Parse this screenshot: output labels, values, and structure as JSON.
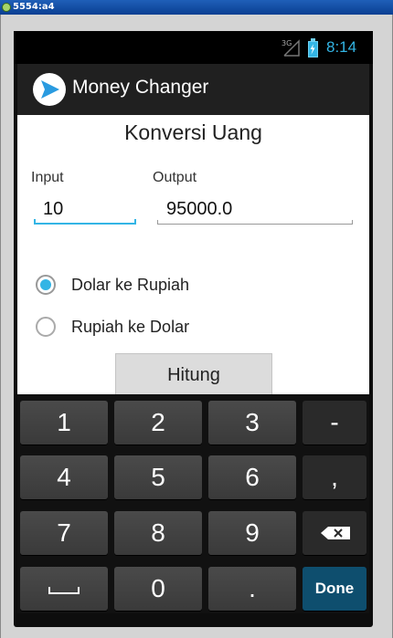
{
  "window": {
    "title": "5554:a4"
  },
  "statusbar": {
    "network": "3G",
    "time": "8:14"
  },
  "actionbar": {
    "app_icon": "send-icon",
    "title": "Money Changer"
  },
  "form": {
    "heading": "Konversi Uang",
    "input_label": "Input",
    "input_value": "10",
    "output_label": "Output",
    "output_value": "95000.0",
    "options": [
      {
        "label": "Dolar ke Rupiah",
        "checked": true
      },
      {
        "label": "Rupiah ke Dolar",
        "checked": false
      }
    ],
    "button_label": "Hitung"
  },
  "keyboard": {
    "rows": [
      [
        "1",
        "2",
        "3",
        "-"
      ],
      [
        "4",
        "5",
        "6",
        ","
      ],
      [
        "7",
        "8",
        "9",
        "backspace"
      ],
      [
        "space",
        "0",
        ".",
        "Done"
      ]
    ],
    "done_label": "Done",
    "colors": {
      "accent": "#33b5e5",
      "done_key": "#0e4e6e"
    }
  }
}
